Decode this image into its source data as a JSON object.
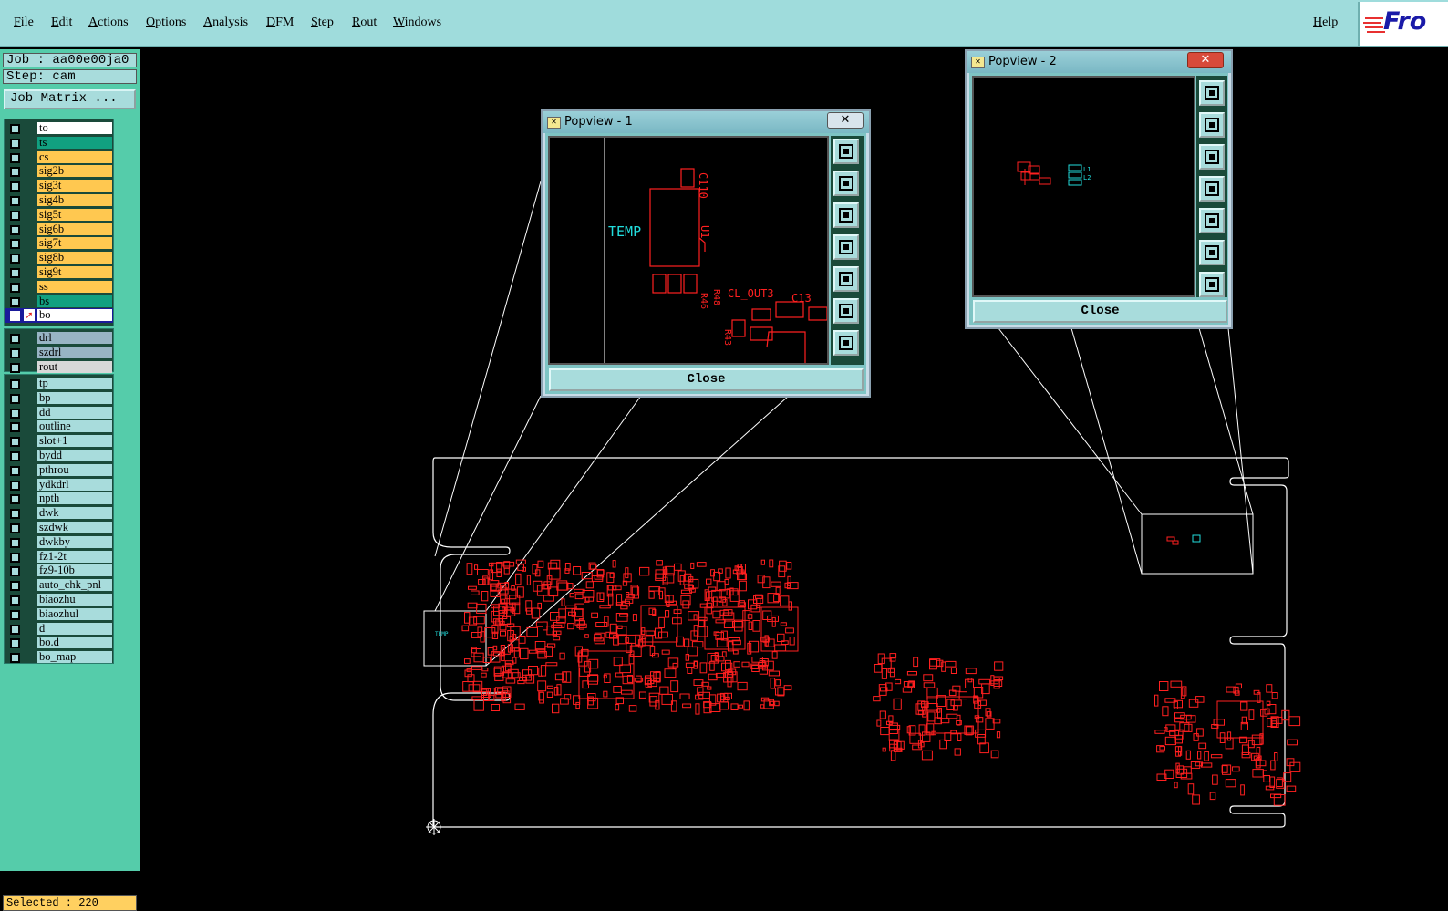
{
  "menu": {
    "items": [
      "File",
      "Edit",
      "Actions",
      "Options",
      "Analysis",
      "DFM",
      "Step",
      "Rout",
      "Windows"
    ],
    "help": "Help"
  },
  "logo": {
    "text": "Fro"
  },
  "job": {
    "job_line": "Job : aa00e00ja0",
    "step_line": "Step: cam",
    "matrix_button": "Job Matrix ..."
  },
  "layers": {
    "board": [
      {
        "name": "to",
        "color": "#ffffff"
      },
      {
        "name": "ts",
        "color": "#11a080"
      },
      {
        "name": "cs",
        "color": "#ffc850"
      },
      {
        "name": "sig2b",
        "color": "#ffc850"
      },
      {
        "name": "sig3t",
        "color": "#ffc850"
      },
      {
        "name": "sig4b",
        "color": "#ffc850"
      },
      {
        "name": "sig5t",
        "color": "#ffc850"
      },
      {
        "name": "sig6b",
        "color": "#ffc850"
      },
      {
        "name": "sig7t",
        "color": "#ffc850"
      },
      {
        "name": "sig8b",
        "color": "#ffc850"
      },
      {
        "name": "sig9t",
        "color": "#ffc850"
      },
      {
        "name": "ss",
        "color": "#ffc850"
      },
      {
        "name": "bs",
        "color": "#11a080"
      },
      {
        "name": "bo",
        "color": "#ffffff",
        "active": true
      }
    ],
    "drill": [
      {
        "name": "drl",
        "color": "#98b4c4"
      },
      {
        "name": "szdrl",
        "color": "#98b4c4"
      },
      {
        "name": "rout",
        "color": "#d8d8d8"
      }
    ],
    "misc": [
      {
        "name": "tp",
        "color": "#a8dcdc"
      },
      {
        "name": "bp",
        "color": "#a8dcdc"
      },
      {
        "name": "dd",
        "color": "#a8dcdc"
      },
      {
        "name": "outline",
        "color": "#a8dcdc"
      },
      {
        "name": "slot+1",
        "color": "#a8dcdc"
      },
      {
        "name": "bydd",
        "color": "#a8dcdc"
      },
      {
        "name": "pthrou",
        "color": "#a8dcdc"
      },
      {
        "name": "ydkdrl",
        "color": "#a8dcdc"
      },
      {
        "name": "npth",
        "color": "#a8dcdc"
      },
      {
        "name": "dwk",
        "color": "#a8dcdc"
      },
      {
        "name": "szdwk",
        "color": "#a8dcdc"
      },
      {
        "name": "dwkby",
        "color": "#a8dcdc"
      },
      {
        "name": "fz1-2t",
        "color": "#a8dcdc"
      },
      {
        "name": "fz9-10b",
        "color": "#a8dcdc"
      },
      {
        "name": "auto_chk_pnl",
        "color": "#a8dcdc"
      },
      {
        "name": "biaozhu",
        "color": "#a8dcdc"
      },
      {
        "name": "biaozhul",
        "color": "#a8dcdc"
      },
      {
        "name": "d",
        "color": "#a8dcdc"
      },
      {
        "name": "bo.d",
        "color": "#a8dcdc"
      },
      {
        "name": "bo_map",
        "color": "#a8dcdc"
      }
    ]
  },
  "status": {
    "selected": "Selected : 220"
  },
  "popview1": {
    "title": "Popview - 1",
    "close_button": "Close",
    "labels": {
      "temp": "TEMP",
      "c110": "C110",
      "u1": "U1",
      "r46": "R46",
      "r48": "R48",
      "cl_out3": "CL_OUT3",
      "c13": "C13",
      "r43": "R43"
    }
  },
  "popview2": {
    "title": "Popview - 2",
    "close_button": "Close",
    "labels": {
      "l1": "L1",
      "l2": "L2"
    }
  },
  "colors": {
    "menubar": "#9fdcdc",
    "panel": "#55ccaa",
    "board_line": "#ffffff",
    "component": "#ff2020",
    "silk_label": "#22dddd"
  }
}
